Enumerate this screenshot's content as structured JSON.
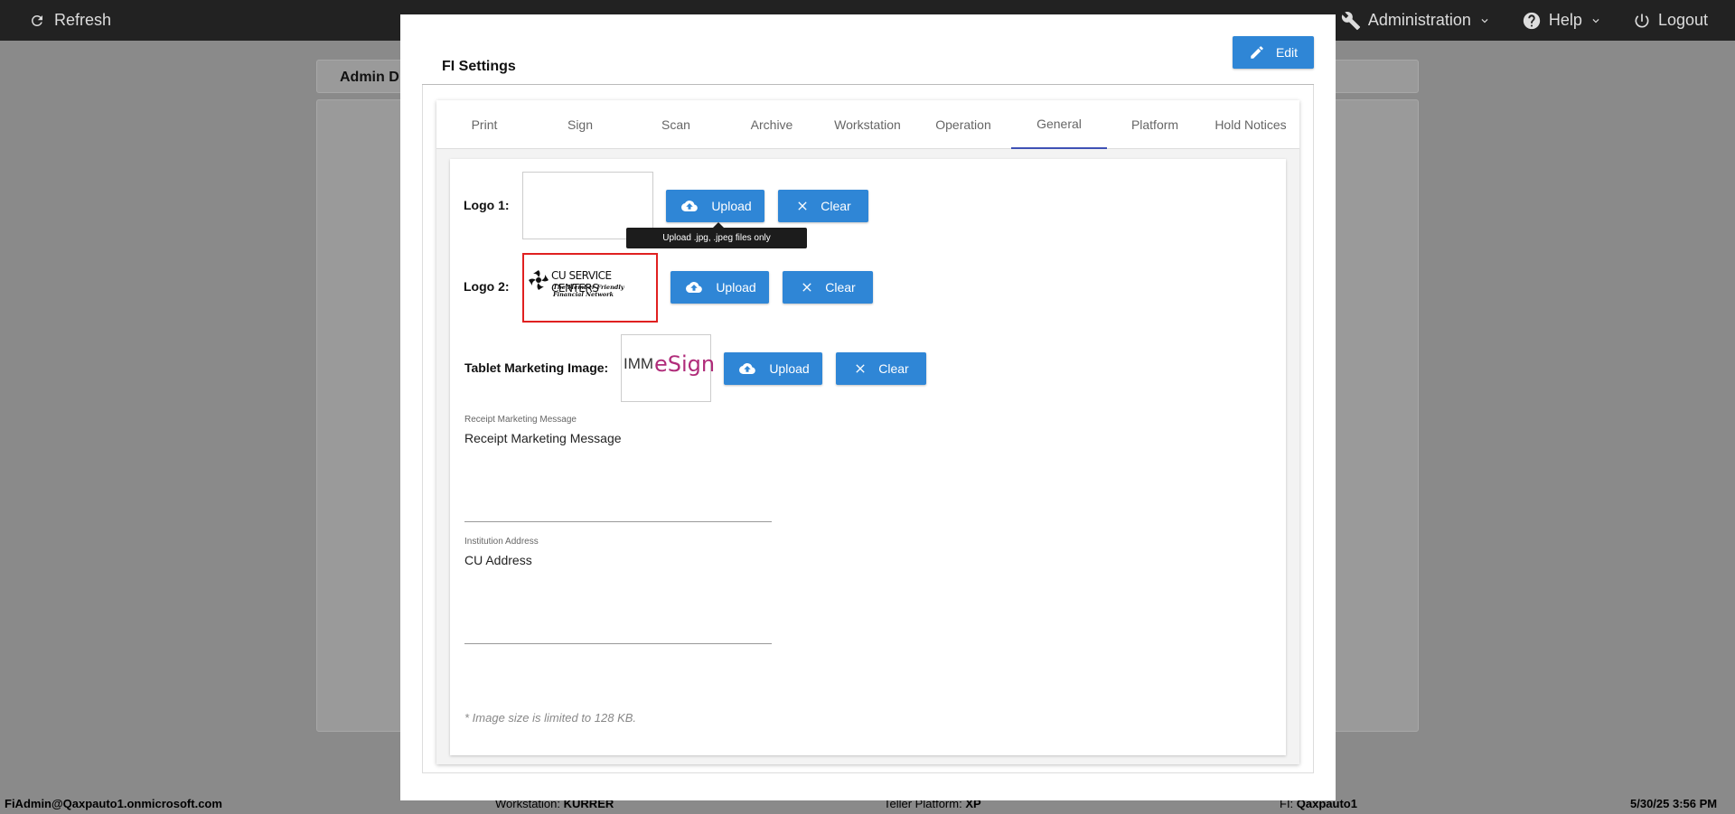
{
  "topbar": {
    "refresh_label": "Refresh",
    "administration_label": "Administration",
    "help_label": "Help",
    "logout_label": "Logout"
  },
  "background": {
    "panel_title": "Admin D"
  },
  "footer": {
    "user": "FiAdmin@Qaxpauto1.onmicrosoft.com",
    "workstation_label": "Workstation:",
    "workstation_value": "KURRER",
    "teller_platform_label": "Teller Platform:",
    "teller_platform_value": "XP",
    "fi_label": "FI:",
    "fi_value": "Qaxpauto1",
    "datetime": "5/30/25 3:56 PM"
  },
  "modal": {
    "title": "FI Settings",
    "edit_label": "Edit",
    "tabs": [
      {
        "label": "Print"
      },
      {
        "label": "Sign"
      },
      {
        "label": "Scan"
      },
      {
        "label": "Archive"
      },
      {
        "label": "Workstation"
      },
      {
        "label": "Operation"
      },
      {
        "label": "General"
      },
      {
        "label": "Platform"
      },
      {
        "label": "Hold Notices"
      }
    ],
    "active_tab": "General"
  },
  "general": {
    "logo1_label": "Logo 1:",
    "logo2_label": "Logo 2:",
    "tablet_label": "Tablet Marketing Image:",
    "upload_label": "Upload",
    "clear_label": "Clear",
    "tooltip": "Upload .jpg, .jpeg files only",
    "logo2_text_line1": "CU SERVICE CENTERS",
    "logo2_text_line2": "The Member Friendly Financial Network",
    "tablet_logo_prefix": "IMM",
    "tablet_logo_brand": "eSign",
    "receipt_label": "Receipt Marketing Message",
    "receipt_value": "Receipt Marketing Message",
    "address_label": "Institution Address",
    "address_value": "CU Address",
    "note": "* Image size is limited to 128 KB."
  },
  "colors": {
    "accent": "#2f86d6",
    "tab_indicator": "#3f51b5",
    "logo2_highlight": "#e02020",
    "esign_brand": "#b02c7a"
  }
}
